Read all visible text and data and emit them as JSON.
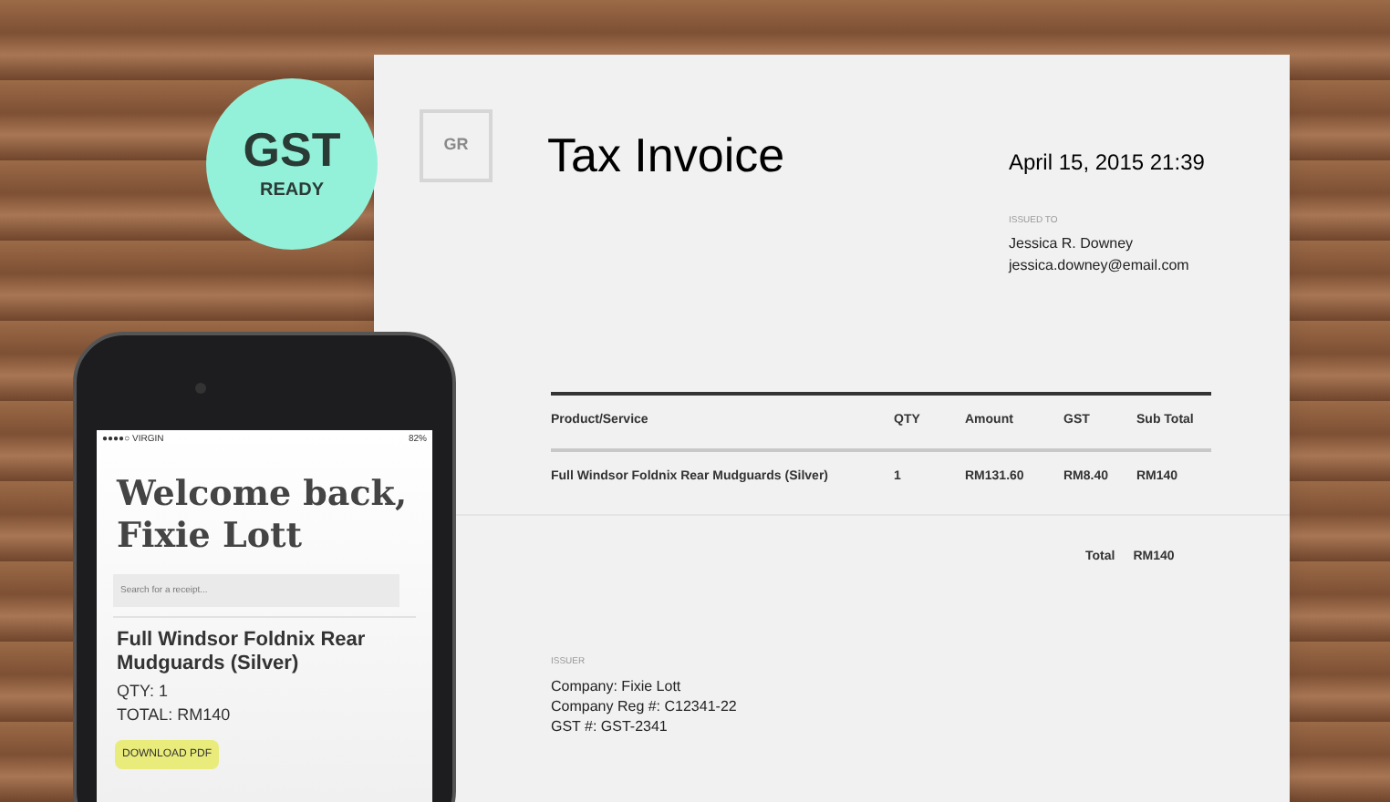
{
  "badge": {
    "logo": "GST",
    "label": "READY"
  },
  "invoice": {
    "logo": "GR",
    "title": "Tax Invoice",
    "date": "April 15, 2015 21:39",
    "issued_to": {
      "label": "ISSUED TO",
      "name": "Jessica R. Downey",
      "email": "jessica.downey@email.com"
    },
    "table": {
      "columns": [
        "Product/Service",
        "QTY",
        "Amount",
        "GST",
        "Sub Total"
      ],
      "rows": [
        [
          "Full Windsor Foldnix Rear Mudguards (Silver)",
          "1",
          "RM131.60",
          "RM8.40",
          "RM140"
        ]
      ]
    },
    "total": {
      "label": "Total",
      "value": "RM140"
    },
    "issuer": {
      "label": "ISSUER",
      "lines": [
        "Company: Fixie Lott",
        "Company Reg #: C12341-22",
        "GST #: GST-2341"
      ]
    }
  },
  "phone": {
    "status_bar": {
      "carrier": "●●●●○ VIRGIN",
      "battery": "82%"
    },
    "greeting": "Welcome back, Fixie Lott",
    "search": {
      "placeholder": "Search for a receipt..."
    },
    "receipt": {
      "title": "Full Windsor Foldnix Rear Mudguards (Silver)",
      "qty": "QTY: 1",
      "total": "TOTAL: RM140",
      "button": "DOWNLOAD PDF"
    }
  }
}
